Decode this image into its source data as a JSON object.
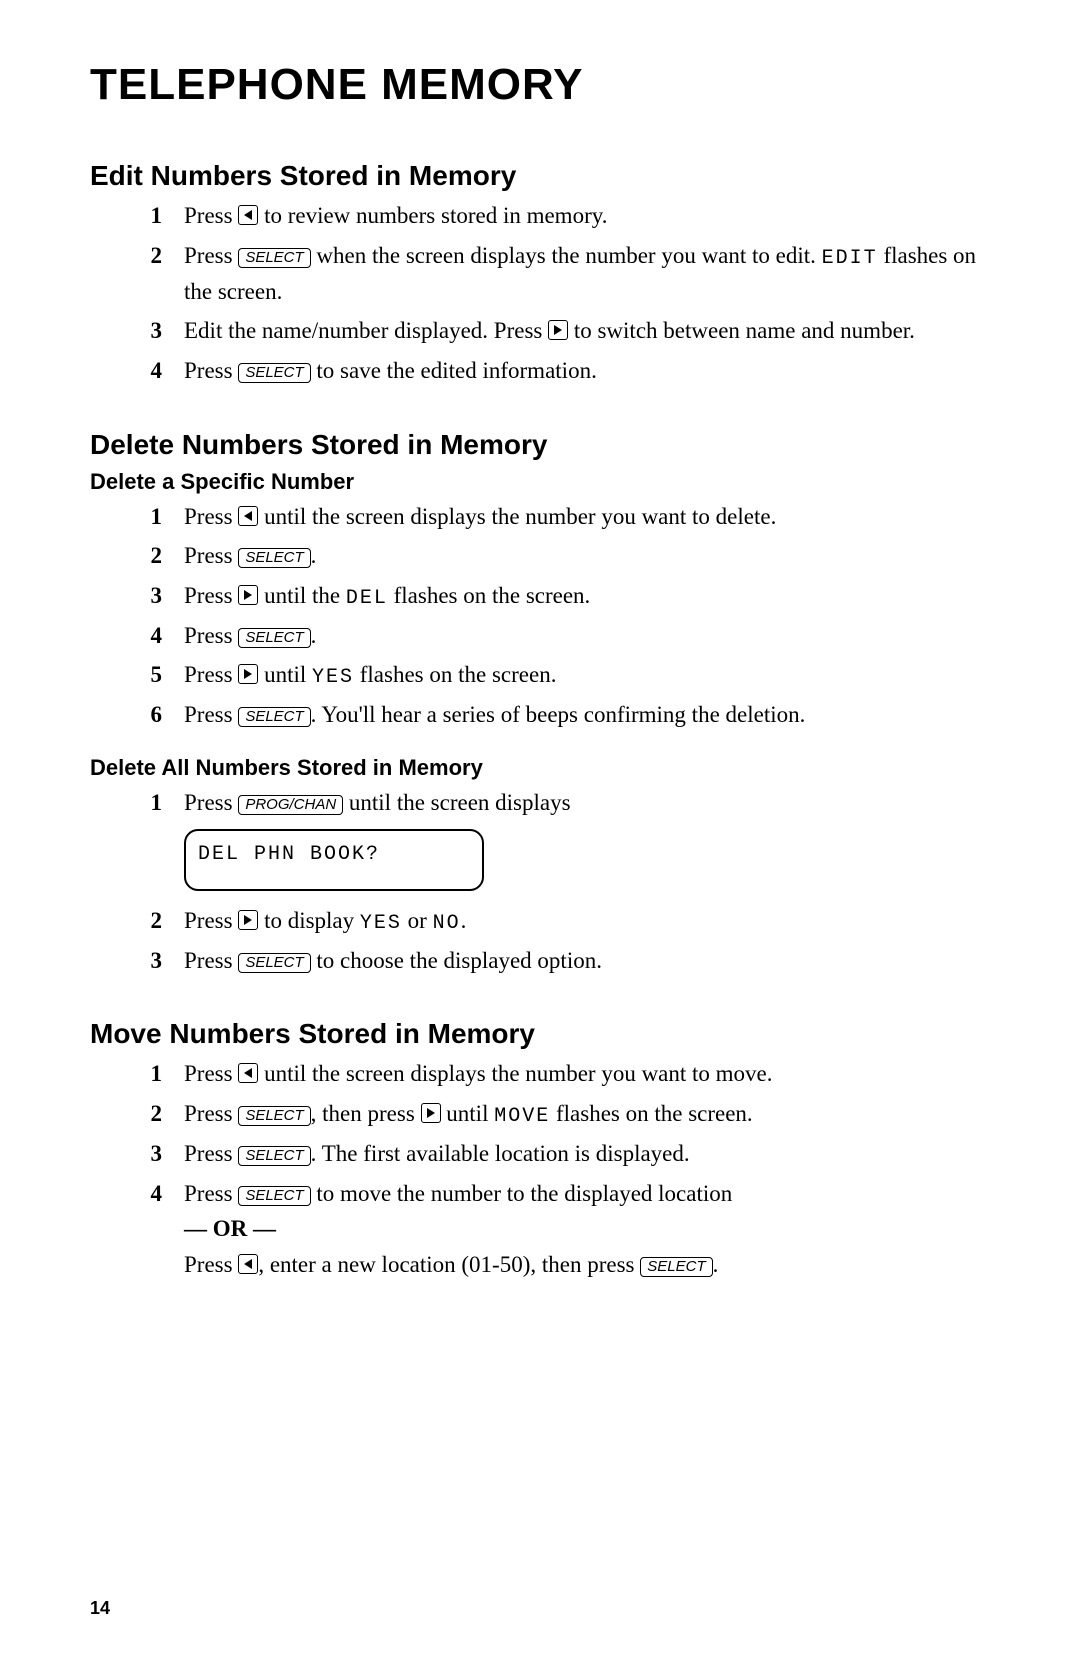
{
  "title": "TELEPHONE MEMORY",
  "page_number": "14",
  "keys": {
    "select": "SELECT",
    "progchan": "PROG/CHAN"
  },
  "lcd": {
    "edit": "EDIT",
    "del": "DEL",
    "yes": "YES",
    "no": "NO",
    "move": "MOVE",
    "del_phn_book": "DEL PHN BOOK?"
  },
  "or_label": "— OR —",
  "sections": {
    "edit": {
      "heading": "Edit Numbers Stored in Memory",
      "steps": {
        "s1a": "Press ",
        "s1b": " to review numbers stored in memory.",
        "s2a": "Press ",
        "s2b": " when the screen displays the number you want to edit. ",
        "s2c": " flashes on the screen.",
        "s3a": "Edit the name/number displayed. Press ",
        "s3b": " to switch between name and number.",
        "s4a": "Press ",
        "s4b": " to save the edited information."
      }
    },
    "delete": {
      "heading": "Delete Numbers Stored in Memory",
      "sub1": {
        "heading": "Delete a Specific Number",
        "steps": {
          "s1a": "Press ",
          "s1b": " until the screen displays the number you want to delete.",
          "s2a": "Press ",
          "s2b": ".",
          "s3a": "Press ",
          "s3b": " until the ",
          "s3c": " flashes on the screen.",
          "s4a": "Press ",
          "s4b": ".",
          "s5a": "Press ",
          "s5b": " until ",
          "s5c": " flashes on the screen.",
          "s6a": "Press ",
          "s6b": ". You'll hear a series of beeps confirming the deletion."
        }
      },
      "sub2": {
        "heading": "Delete All Numbers Stored in Memory",
        "steps": {
          "s1a": "Press ",
          "s1b": " until the screen displays",
          "s2a": "Press ",
          "s2b": " to display ",
          "s2c": " or ",
          "s2d": ".",
          "s3a": "Press ",
          "s3b": " to choose the displayed option."
        }
      }
    },
    "move": {
      "heading": "Move Numbers Stored in Memory",
      "steps": {
        "s1a": "Press ",
        "s1b": " until the screen displays the number you want to move.",
        "s2a": "Press ",
        "s2b": ", then press ",
        "s2c": " until ",
        "s2d": " flashes on the screen.",
        "s3a": "Press ",
        "s3b": ". The first available location is displayed.",
        "s4a": "Press ",
        "s4b": " to move the number to the displayed location",
        "s4c": "Press ",
        "s4d": ", enter a new location (01-50), then press ",
        "s4e": "."
      }
    }
  }
}
